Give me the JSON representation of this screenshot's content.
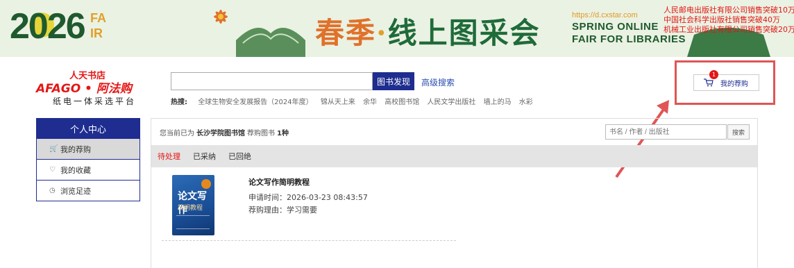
{
  "banner": {
    "year": "2026",
    "fair_logo_text": "FAIR",
    "title_part1": "春季",
    "title_dot": "·",
    "title_part2": "线上图采会",
    "url": "https://d.cxstar.com",
    "en_line1": "SPRING ONLINE",
    "en_line2": "FAIR FOR LIBRARIES",
    "ticker": [
      "人民邮电出版社有限公司销售突破10万",
      "中国社会科学出版社销售突破40万",
      "机械工业出版社有限公司销售突破20万"
    ]
  },
  "logo": {
    "top": "人天书店",
    "brand": "AFAGO • 阿法购",
    "sub": "纸电一体采选平台"
  },
  "search": {
    "value": "",
    "button": "图书发现",
    "advanced": "高级搜索",
    "hot_label": "热搜:",
    "hot_keywords": [
      "全球生物安全发展报告（2024年度）",
      "锦从天上来",
      "余华",
      "高校图书馆",
      "人民文学出版社",
      "墙上的马",
      "水彩"
    ]
  },
  "cart": {
    "label": "我的荐购",
    "badge": "1"
  },
  "sidebar": {
    "header": "个人中心",
    "items": [
      {
        "label": "我的荐购",
        "icon": "cart-icon"
      },
      {
        "label": "我的收藏",
        "icon": "heart-icon"
      },
      {
        "label": "浏览足迹",
        "icon": "history-icon"
      }
    ]
  },
  "main": {
    "status_prefix": "您当前已为",
    "library": "长沙学院图书馆",
    "status_mid": "荐购图书",
    "count": "1种",
    "filter_placeholder": "书名 / 作者 / 出版社",
    "filter_button": "搜索",
    "tabs": [
      "待处理",
      "已采纳",
      "已回绝"
    ],
    "item": {
      "title": "论文写作简明教程",
      "apply_time": "申请时间：2026-03-23 08:43:57",
      "reason": "荐购理由：学习需要",
      "cover_title": "论文写作",
      "cover_sub": "简明教程"
    }
  },
  "colors": {
    "primary": "#1e2d8f",
    "accent_red": "#e51616",
    "banner_bg": "#eaf2e3"
  }
}
